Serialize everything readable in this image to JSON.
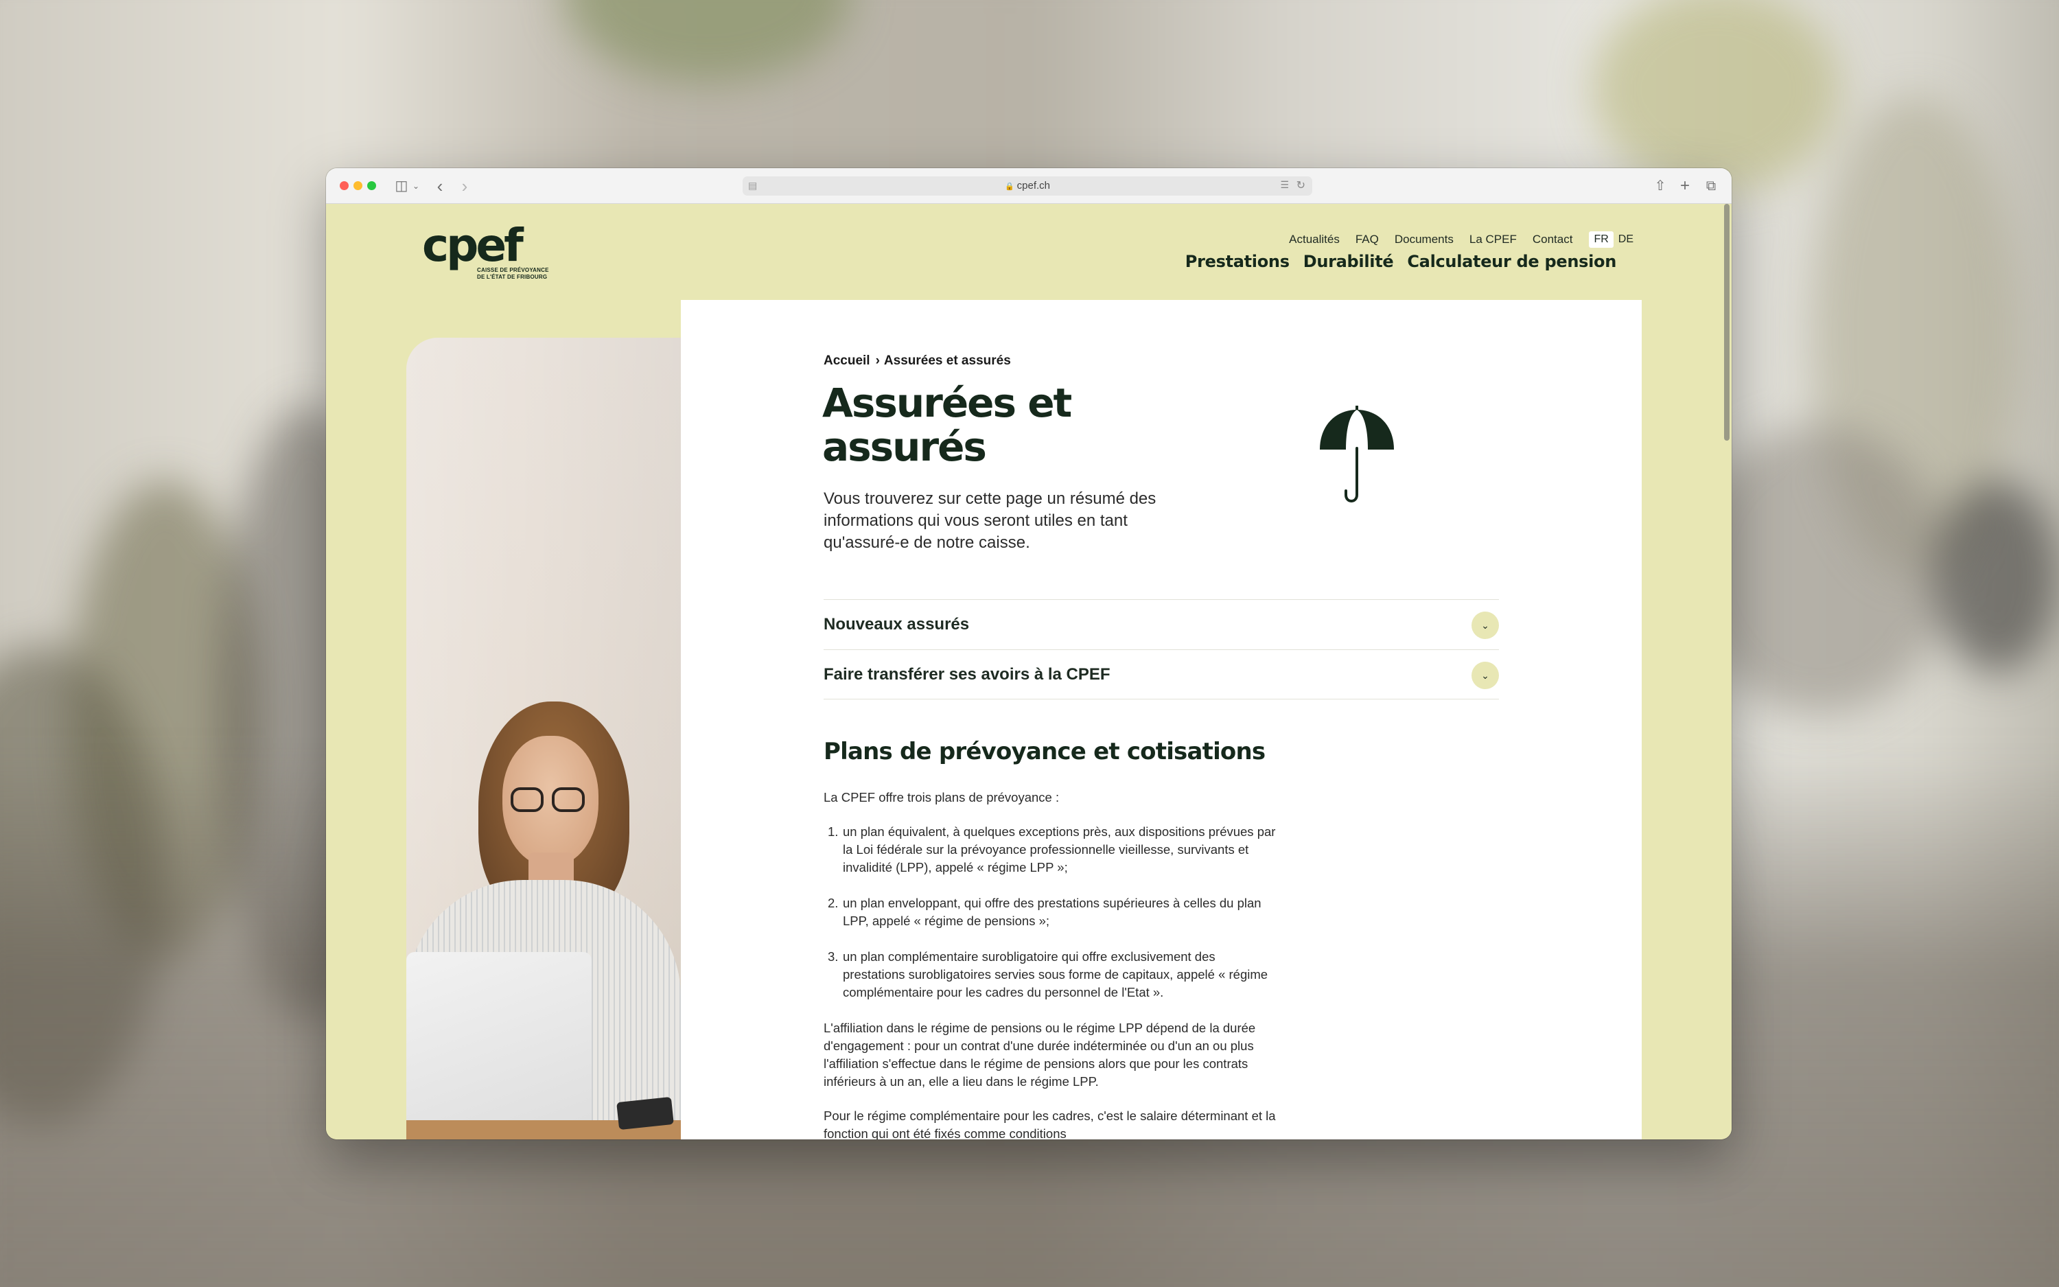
{
  "browser": {
    "url": "cpef.ch"
  },
  "logo": {
    "mark": "cpef",
    "line1": "CAISSE DE PRÉVOYANCE",
    "line2": "DE L'ÉTAT DE FRIBOURG"
  },
  "utility_nav": [
    "Actualités",
    "FAQ",
    "Documents",
    "La CPEF",
    "Contact"
  ],
  "languages": {
    "active": "FR",
    "other": "DE"
  },
  "main_nav": [
    "Prestations",
    "Durabilité",
    "Calculateur de pension"
  ],
  "breadcrumb": {
    "home": "Accueil",
    "separator": "›",
    "current": "Assurées et assurés"
  },
  "page": {
    "title": "Assurées et assurés",
    "intro": "Vous trouverez sur cette page un résumé des informations qui vous seront utiles en tant qu'assuré-e de notre caisse.",
    "icon": "umbrella-icon"
  },
  "accordion": [
    {
      "label": "Nouveaux assurés"
    },
    {
      "label": "Faire transférer ses avoirs à la CPEF"
    }
  ],
  "section": {
    "title": "Plans de prévoyance et cotisations",
    "lead": "La CPEF offre trois plans de prévoyance :",
    "plans": [
      "un plan équivalent, à quelques exceptions près, aux dispositions prévues par la Loi fédérale sur la prévoyance professionnelle vieillesse, survivants et invalidité (LPP), appelé « régime LPP »;",
      "un plan enveloppant, qui offre des prestations supérieures à celles du plan LPP, appelé « régime de pensions »;",
      "un plan complémentaire surobligatoire qui offre exclusivement des prestations surobligatoires servies sous forme de capitaux, appelé « régime complémentaire pour les cadres du personnel de l'Etat »."
    ],
    "paragraph": "L'affiliation dans le régime de pensions ou le régime LPP dépend de la durée d'engagement : pour un contrat d'une durée indéterminée ou d'un an ou plus l'affiliation s'effectue dans le régime de pensions alors que pour les contrats inférieurs à un an, elle a lieu dans le régime LPP.",
    "paragraph_2": "Pour le régime complémentaire pour les cadres, c'est le salaire déterminant et la fonction qui ont été fixés comme conditions"
  },
  "colors": {
    "site_background": "#e8e7b4",
    "brand_dark_green": "#16291c",
    "panel": "#ffffff"
  }
}
